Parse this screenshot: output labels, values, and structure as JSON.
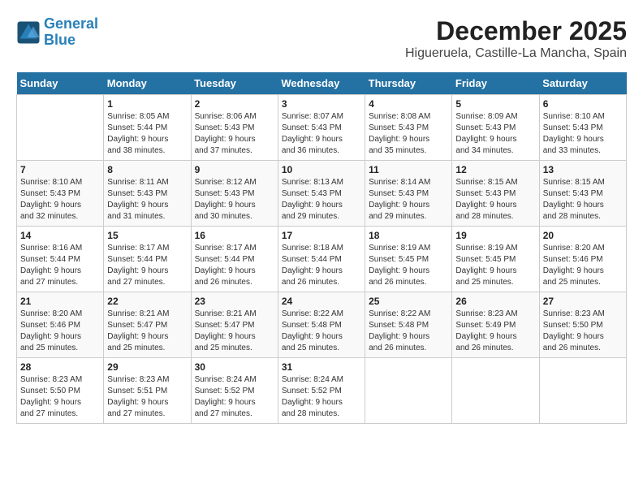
{
  "header": {
    "logo_line1": "General",
    "logo_line2": "Blue",
    "title": "December 2025",
    "subtitle": "Higueruela, Castille-La Mancha, Spain"
  },
  "calendar": {
    "days_of_week": [
      "Sunday",
      "Monday",
      "Tuesday",
      "Wednesday",
      "Thursday",
      "Friday",
      "Saturday"
    ],
    "weeks": [
      [
        {
          "day": "",
          "info": ""
        },
        {
          "day": "1",
          "info": "Sunrise: 8:05 AM\nSunset: 5:44 PM\nDaylight: 9 hours\nand 38 minutes."
        },
        {
          "day": "2",
          "info": "Sunrise: 8:06 AM\nSunset: 5:43 PM\nDaylight: 9 hours\nand 37 minutes."
        },
        {
          "day": "3",
          "info": "Sunrise: 8:07 AM\nSunset: 5:43 PM\nDaylight: 9 hours\nand 36 minutes."
        },
        {
          "day": "4",
          "info": "Sunrise: 8:08 AM\nSunset: 5:43 PM\nDaylight: 9 hours\nand 35 minutes."
        },
        {
          "day": "5",
          "info": "Sunrise: 8:09 AM\nSunset: 5:43 PM\nDaylight: 9 hours\nand 34 minutes."
        },
        {
          "day": "6",
          "info": "Sunrise: 8:10 AM\nSunset: 5:43 PM\nDaylight: 9 hours\nand 33 minutes."
        }
      ],
      [
        {
          "day": "7",
          "info": "Sunrise: 8:10 AM\nSunset: 5:43 PM\nDaylight: 9 hours\nand 32 minutes."
        },
        {
          "day": "8",
          "info": "Sunrise: 8:11 AM\nSunset: 5:43 PM\nDaylight: 9 hours\nand 31 minutes."
        },
        {
          "day": "9",
          "info": "Sunrise: 8:12 AM\nSunset: 5:43 PM\nDaylight: 9 hours\nand 30 minutes."
        },
        {
          "day": "10",
          "info": "Sunrise: 8:13 AM\nSunset: 5:43 PM\nDaylight: 9 hours\nand 29 minutes."
        },
        {
          "day": "11",
          "info": "Sunrise: 8:14 AM\nSunset: 5:43 PM\nDaylight: 9 hours\nand 29 minutes."
        },
        {
          "day": "12",
          "info": "Sunrise: 8:15 AM\nSunset: 5:43 PM\nDaylight: 9 hours\nand 28 minutes."
        },
        {
          "day": "13",
          "info": "Sunrise: 8:15 AM\nSunset: 5:43 PM\nDaylight: 9 hours\nand 28 minutes."
        }
      ],
      [
        {
          "day": "14",
          "info": "Sunrise: 8:16 AM\nSunset: 5:44 PM\nDaylight: 9 hours\nand 27 minutes."
        },
        {
          "day": "15",
          "info": "Sunrise: 8:17 AM\nSunset: 5:44 PM\nDaylight: 9 hours\nand 27 minutes."
        },
        {
          "day": "16",
          "info": "Sunrise: 8:17 AM\nSunset: 5:44 PM\nDaylight: 9 hours\nand 26 minutes."
        },
        {
          "day": "17",
          "info": "Sunrise: 8:18 AM\nSunset: 5:44 PM\nDaylight: 9 hours\nand 26 minutes."
        },
        {
          "day": "18",
          "info": "Sunrise: 8:19 AM\nSunset: 5:45 PM\nDaylight: 9 hours\nand 26 minutes."
        },
        {
          "day": "19",
          "info": "Sunrise: 8:19 AM\nSunset: 5:45 PM\nDaylight: 9 hours\nand 25 minutes."
        },
        {
          "day": "20",
          "info": "Sunrise: 8:20 AM\nSunset: 5:46 PM\nDaylight: 9 hours\nand 25 minutes."
        }
      ],
      [
        {
          "day": "21",
          "info": "Sunrise: 8:20 AM\nSunset: 5:46 PM\nDaylight: 9 hours\nand 25 minutes."
        },
        {
          "day": "22",
          "info": "Sunrise: 8:21 AM\nSunset: 5:47 PM\nDaylight: 9 hours\nand 25 minutes."
        },
        {
          "day": "23",
          "info": "Sunrise: 8:21 AM\nSunset: 5:47 PM\nDaylight: 9 hours\nand 25 minutes."
        },
        {
          "day": "24",
          "info": "Sunrise: 8:22 AM\nSunset: 5:48 PM\nDaylight: 9 hours\nand 25 minutes."
        },
        {
          "day": "25",
          "info": "Sunrise: 8:22 AM\nSunset: 5:48 PM\nDaylight: 9 hours\nand 26 minutes."
        },
        {
          "day": "26",
          "info": "Sunrise: 8:23 AM\nSunset: 5:49 PM\nDaylight: 9 hours\nand 26 minutes."
        },
        {
          "day": "27",
          "info": "Sunrise: 8:23 AM\nSunset: 5:50 PM\nDaylight: 9 hours\nand 26 minutes."
        }
      ],
      [
        {
          "day": "28",
          "info": "Sunrise: 8:23 AM\nSunset: 5:50 PM\nDaylight: 9 hours\nand 27 minutes."
        },
        {
          "day": "29",
          "info": "Sunrise: 8:23 AM\nSunset: 5:51 PM\nDaylight: 9 hours\nand 27 minutes."
        },
        {
          "day": "30",
          "info": "Sunrise: 8:24 AM\nSunset: 5:52 PM\nDaylight: 9 hours\nand 27 minutes."
        },
        {
          "day": "31",
          "info": "Sunrise: 8:24 AM\nSunset: 5:52 PM\nDaylight: 9 hours\nand 28 minutes."
        },
        {
          "day": "",
          "info": ""
        },
        {
          "day": "",
          "info": ""
        },
        {
          "day": "",
          "info": ""
        }
      ]
    ]
  }
}
